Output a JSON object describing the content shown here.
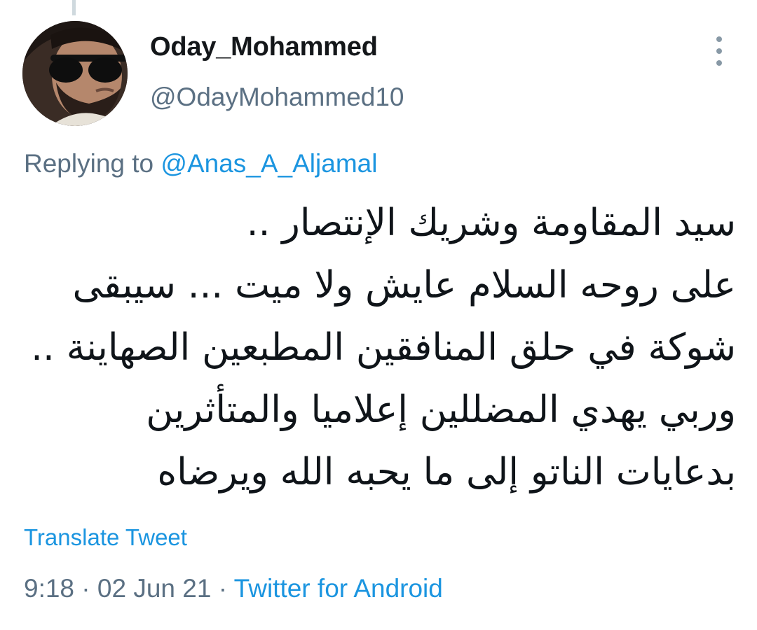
{
  "tweet": {
    "author": {
      "display_name": "Oday_Mohammed",
      "handle": "@OdayMohammed10"
    },
    "replying_prefix": "Replying to",
    "replying_to": "@Anas_A_Aljamal",
    "text_lines": [
      "سيد المقاومة وشريك الإنتصار ..",
      "على روحه السلام عايش ولا ميت ... سيبقى",
      "شوكة في حلق المنافقين المطبعين الصهاينة ..",
      "وربي يهدي المضللين إعلاميا والمتأثرين",
      "بدعايات الناتو إلى ما يحبه الله ويرضاه"
    ],
    "translate_label": "Translate Tweet",
    "time": "9:18",
    "separator": "·",
    "date": "02 Jun 21",
    "source": "Twitter for Android"
  },
  "icons": {
    "more": "more-vertical-icon"
  },
  "colors": {
    "name": "#14171a",
    "secondary": "#5b7083",
    "link": "#1b95e0",
    "text": "#0f1419",
    "background": "#ffffff"
  }
}
